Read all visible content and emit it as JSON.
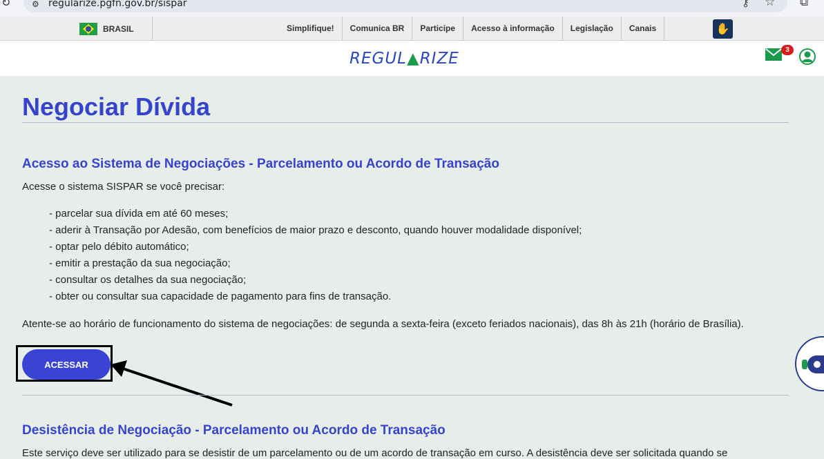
{
  "browser": {
    "url": "regularize.pgfn.gov.br/sispar"
  },
  "gov_bar": {
    "country_label": "BRASIL",
    "links": [
      "Simplifique!",
      "Comunica BR",
      "Participe",
      "Acesso à informação",
      "Legislação",
      "Canais"
    ]
  },
  "header": {
    "logo_left": "REGUL",
    "logo_right": "RIZE",
    "mail_badge_count": "3",
    "colors": {
      "brand_blue": "#2b46c2",
      "brand_green": "#1a9c4c"
    }
  },
  "main": {
    "page_title": "Negociar Dívida",
    "section1": {
      "title": "Acesso ao Sistema de Negociações - Parcelamento ou Acordo de Transação",
      "intro": "Acesse o sistema SISPAR se você precisar:",
      "bullets": [
        "- parcelar sua dívida em até 60 meses;",
        "- aderir à Transação por Adesão, com benefícios de maior prazo e desconto, quando houver modalidade disponível;",
        "- optar pelo débito automático;",
        "- emitir a prestação da sua negociação;",
        "- consultar os detalhes da sua negociação;",
        "- obter ou consultar sua capacidade de pagamento para fins de transação."
      ],
      "notice": "Atente-se ao horário de funcionamento do sistema de negociações: de segunda a sexta-feira (exceto feriados nacionais), das 8h às 21h (horário de Brasília).",
      "button_label": "ACESSAR"
    },
    "section2": {
      "title": "Desistência de Negociação - Parcelamento ou Acordo de Transação",
      "text": "Este serviço deve ser utilizado para se desistir de um parcelamento ou de um acordo de transação em curso. A desistência deve ser solicitada quando se"
    }
  }
}
